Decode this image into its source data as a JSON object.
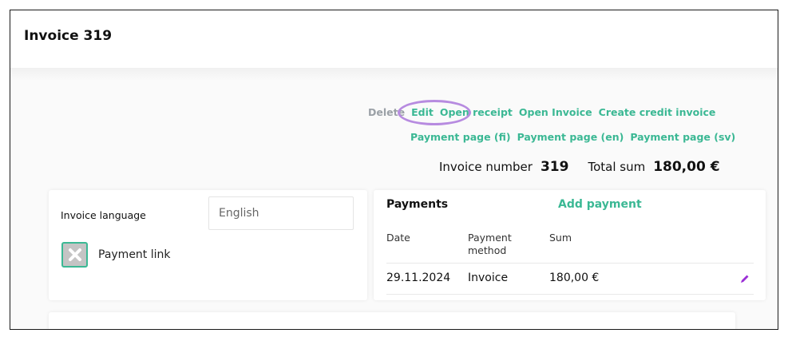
{
  "page": {
    "title": "Invoice 319"
  },
  "actions": {
    "row1": [
      "Delete",
      "Edit",
      "Open receipt",
      "Open Invoice",
      "Create credit invoice"
    ],
    "row2": [
      "Payment page (fi)",
      "Payment page (en)",
      "Payment page (sv)"
    ]
  },
  "totals": {
    "invoice_number_label": "Invoice number",
    "invoice_number": "319",
    "total_sum_label": "Total sum",
    "total_sum": "180,00 €"
  },
  "settings": {
    "language_label": "Invoice language",
    "language_value": "English",
    "payment_link_label": "Payment link",
    "payment_link_checked": false
  },
  "payments": {
    "title": "Payments",
    "add_label": "Add payment",
    "columns": [
      "Date",
      "Payment method",
      "Sum"
    ],
    "rows": [
      {
        "date": "29.11.2024",
        "method": "Invoice",
        "sum": "180,00 €"
      }
    ]
  },
  "colors": {
    "accent": "#3bb894",
    "muted": "#9aa0a6",
    "highlight": "#b78be0",
    "edit_icon": "#9b2fd6"
  }
}
